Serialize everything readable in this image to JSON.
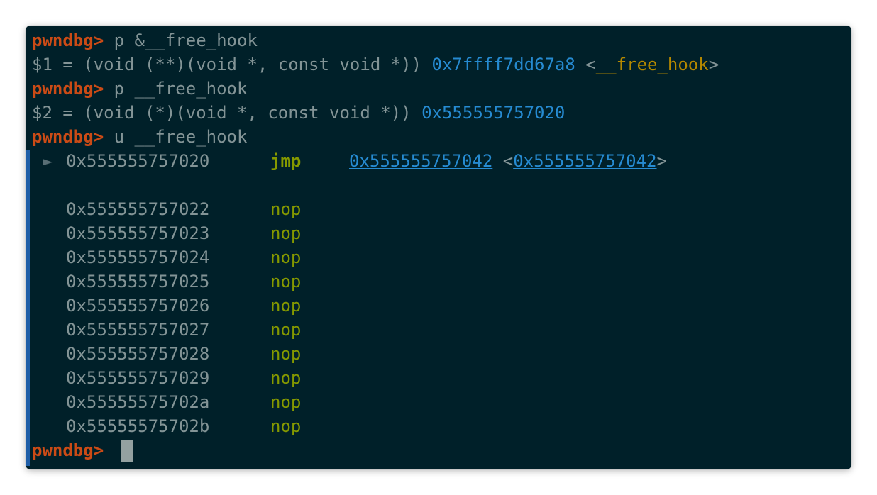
{
  "prompt": "pwndbg>",
  "history": [
    {
      "command": "p &__free_hook",
      "result_prefix": "$1 = (void (**)(void *, const void *)) ",
      "result_addr": "0x7ffff7dd67a8",
      "result_sym_open": " <",
      "result_sym": "__free_hook",
      "result_sym_close": ">"
    },
    {
      "command": "p __free_hook",
      "result_prefix": "$2 = (void (*)(void *, const void *)) ",
      "result_addr": "0x555555757020"
    },
    {
      "command": "u __free_hook"
    }
  ],
  "disassembly": {
    "current_marker": "►",
    "current": {
      "addr": "0x555555757020",
      "mnemonic": "jmp",
      "target": "0x555555757042",
      "target_sym_open": "<",
      "target_sym": "0x555555757042",
      "target_sym_close": ">"
    },
    "rows": [
      {
        "addr": "0x555555757022",
        "mnemonic": "nop"
      },
      {
        "addr": "0x555555757023",
        "mnemonic": "nop"
      },
      {
        "addr": "0x555555757024",
        "mnemonic": "nop"
      },
      {
        "addr": "0x555555757025",
        "mnemonic": "nop"
      },
      {
        "addr": "0x555555757026",
        "mnemonic": "nop"
      },
      {
        "addr": "0x555555757027",
        "mnemonic": "nop"
      },
      {
        "addr": "0x555555757028",
        "mnemonic": "nop"
      },
      {
        "addr": "0x555555757029",
        "mnemonic": "nop"
      },
      {
        "addr": "0x55555575702a",
        "mnemonic": "nop"
      },
      {
        "addr": "0x55555575702b",
        "mnemonic": "nop"
      }
    ]
  },
  "colors": {
    "background": "#002029",
    "prompt": "#cb4b16",
    "text": "#839496",
    "address": "#268bd2",
    "symbol": "#b58900",
    "mnemonic": "#859900",
    "block_marker": "#1e5ea8"
  }
}
